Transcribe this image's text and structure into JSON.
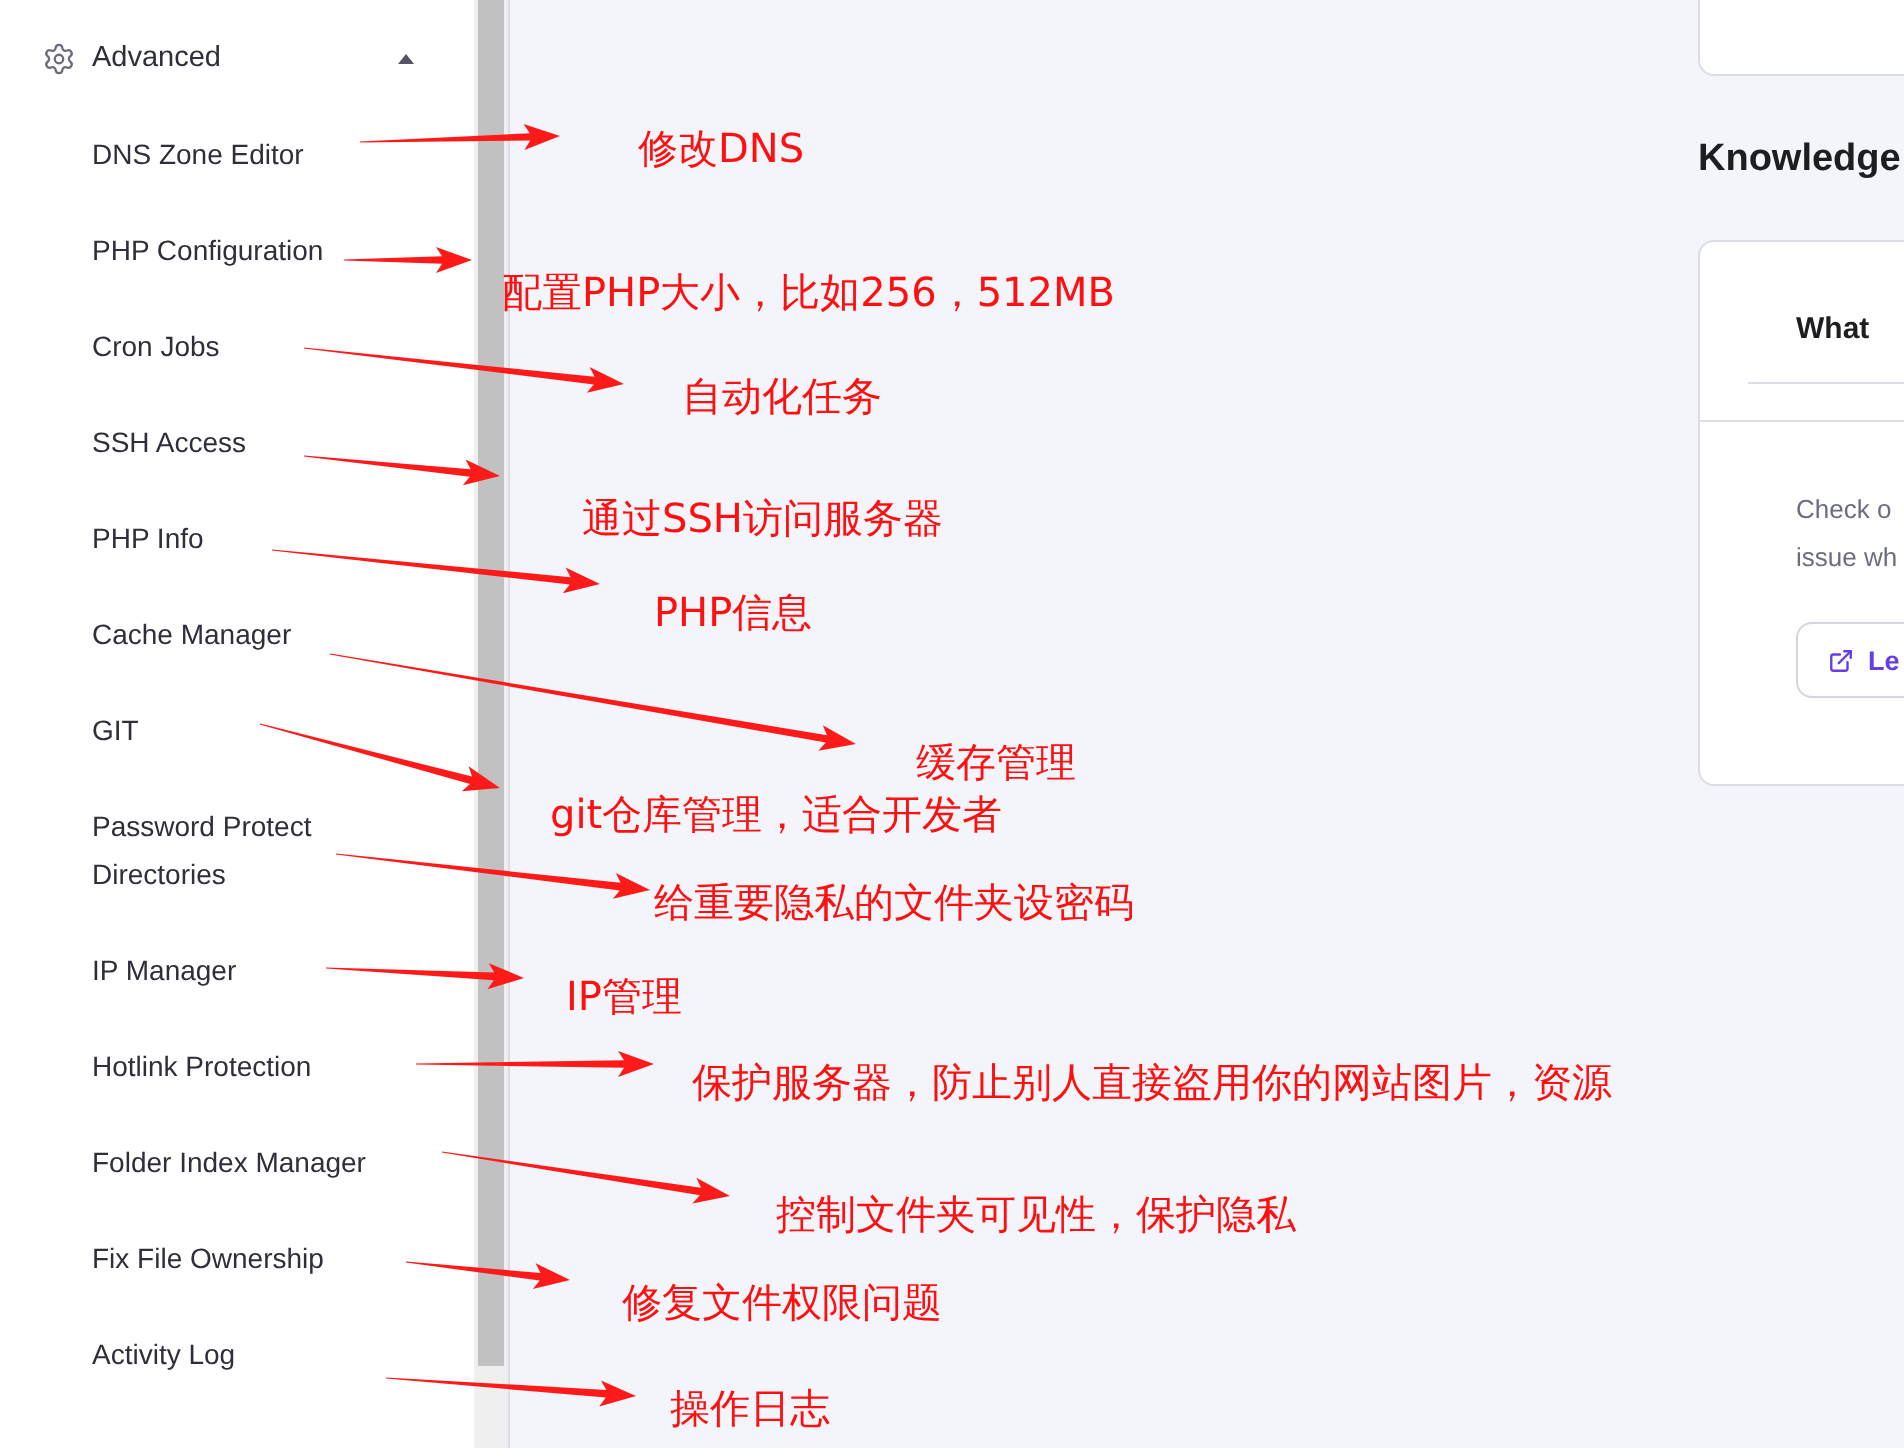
{
  "sidebar": {
    "section": {
      "label": "Advanced",
      "expanded": true
    },
    "items": [
      {
        "label": "DNS Zone Editor"
      },
      {
        "label": "PHP Configuration"
      },
      {
        "label": "Cron Jobs"
      },
      {
        "label": "SSH Access"
      },
      {
        "label": "PHP Info"
      },
      {
        "label": "Cache Manager"
      },
      {
        "label": "GIT"
      },
      {
        "label": "Password Protect Directories"
      },
      {
        "label": "IP Manager"
      },
      {
        "label": "Hotlink Protection"
      },
      {
        "label": "Folder Index Manager"
      },
      {
        "label": "Fix File Ownership"
      },
      {
        "label": "Activity Log"
      }
    ]
  },
  "main": {
    "heading": "Knowledge",
    "card": {
      "title": "What",
      "lines": [
        "Check o",
        "issue wh"
      ],
      "button": "Le"
    }
  },
  "annotations": [
    {
      "text": "修改DNS"
    },
    {
      "text": "配置PHP大小，比如256，512MB"
    },
    {
      "text": "自动化任务"
    },
    {
      "text": "通过SSH访问服务器"
    },
    {
      "text": "PHP信息"
    },
    {
      "text": "缓存管理"
    },
    {
      "text": "git仓库管理，适合开发者"
    },
    {
      "text": "给重要隐私的文件夹设密码"
    },
    {
      "text": "IP管理"
    },
    {
      "text": "保护服务器，防止别人直接盗用你的网站图片，资源"
    },
    {
      "text": "控制文件夹可见性，保护隐私"
    },
    {
      "text": "修复文件权限问题"
    },
    {
      "text": "操作日志"
    }
  ]
}
